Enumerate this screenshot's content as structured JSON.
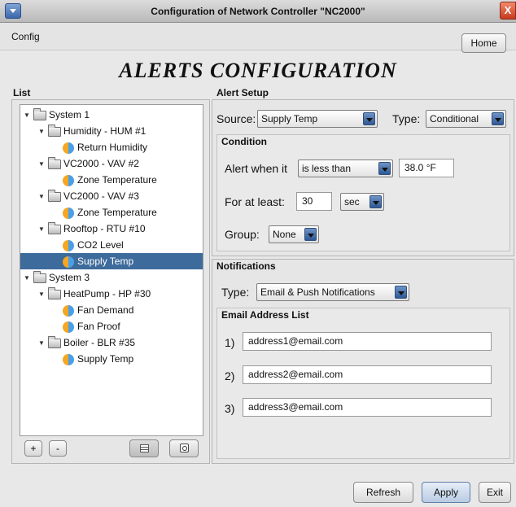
{
  "window": {
    "title": "Configuration of Network Controller \"NC2000\"",
    "close_glyph": "X"
  },
  "menu": {
    "config_label": "Config",
    "home_label": "Home"
  },
  "page": {
    "heading": "ALERTS CONFIGURATION"
  },
  "list": {
    "label": "List",
    "nodes": [
      {
        "label": "System 1",
        "type": "folder",
        "level": 0,
        "expanded": true,
        "selected": false
      },
      {
        "label": "Humidity - HUM #1",
        "type": "folder",
        "level": 1,
        "expanded": true,
        "selected": false
      },
      {
        "label": "Return Humidity",
        "type": "sensor",
        "level": 2,
        "selected": false
      },
      {
        "label": "VC2000 - VAV #2",
        "type": "folder",
        "level": 1,
        "expanded": true,
        "selected": false
      },
      {
        "label": "Zone Temperature",
        "type": "sensor",
        "level": 2,
        "selected": false
      },
      {
        "label": "VC2000 - VAV #3",
        "type": "folder",
        "level": 1,
        "expanded": true,
        "selected": false
      },
      {
        "label": "Zone Temperature",
        "type": "sensor",
        "level": 2,
        "selected": false
      },
      {
        "label": "Rooftop - RTU #10",
        "type": "folder",
        "level": 1,
        "expanded": true,
        "selected": false
      },
      {
        "label": "CO2 Level",
        "type": "sensor",
        "level": 2,
        "selected": false
      },
      {
        "label": "Supply Temp",
        "type": "sensor",
        "level": 2,
        "selected": true
      },
      {
        "label": "System 3",
        "type": "folder",
        "level": 0,
        "expanded": true,
        "selected": false
      },
      {
        "label": "HeatPump - HP #30",
        "type": "folder",
        "level": 1,
        "expanded": true,
        "selected": false
      },
      {
        "label": "Fan Demand",
        "type": "sensor",
        "level": 2,
        "selected": false
      },
      {
        "label": "Fan Proof",
        "type": "sensor",
        "level": 2,
        "selected": false
      },
      {
        "label": "Boiler - BLR #35",
        "type": "folder",
        "level": 1,
        "expanded": true,
        "selected": false
      },
      {
        "label": "Supply Temp",
        "type": "sensor",
        "level": 2,
        "selected": false
      }
    ],
    "add_label": "+",
    "remove_label": "-"
  },
  "alert_setup": {
    "label": "Alert Setup",
    "source_label": "Source:",
    "source_value": "Supply Temp",
    "type_label": "Type:",
    "type_value": "Conditional",
    "condition": {
      "label": "Condition",
      "alert_when_label": "Alert when it",
      "operator_value": "is less than",
      "threshold_value": "38.0 °F",
      "for_at_least_label": "For at least:",
      "duration_value": "30",
      "duration_unit": "sec",
      "group_label": "Group:",
      "group_value": "None"
    }
  },
  "notifications": {
    "label": "Notifications",
    "type_label": "Type:",
    "type_value": "Email & Push Notifications",
    "email_list_label": "Email Address List",
    "emails": [
      {
        "index": "1)",
        "address": "address1@email.com"
      },
      {
        "index": "2)",
        "address": "address2@email.com"
      },
      {
        "index": "3)",
        "address": "address3@email.com"
      }
    ]
  },
  "footer": {
    "refresh_label": "Refresh",
    "apply_label": "Apply",
    "exit_label": "Exit"
  }
}
